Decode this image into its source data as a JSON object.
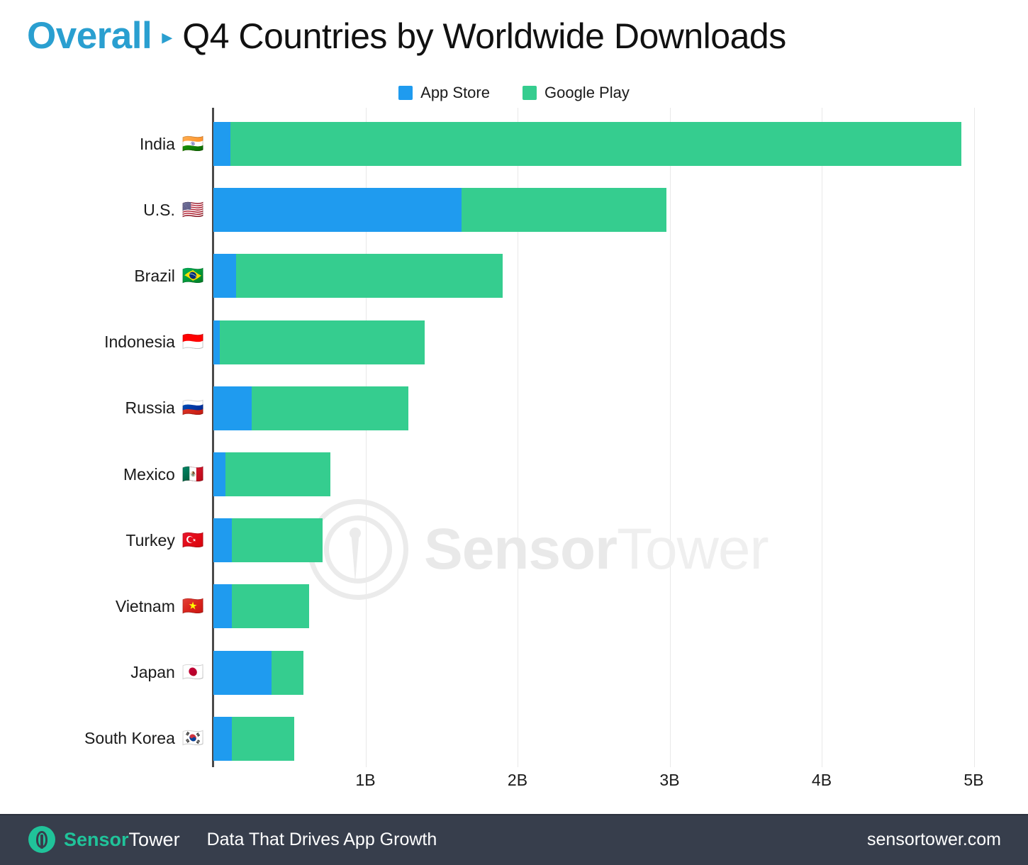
{
  "header": {
    "category": "Overall",
    "separator": "▸",
    "title": "Q4 Countries by Worldwide Downloads"
  },
  "legend": {
    "position": "top-center",
    "items": [
      {
        "label": "App Store",
        "color": "#1f9bef",
        "icon": "square-swatch"
      },
      {
        "label": "Google Play",
        "color": "#35cd8f",
        "icon": "square-swatch"
      }
    ]
  },
  "watermark": {
    "sensor": "Sensor",
    "tower": "Tower",
    "icon": "sensortower-logo-icon"
  },
  "footer": {
    "logo_icon": "sensortower-logo-icon",
    "brand_sensor": "Sensor",
    "brand_tower": "Tower",
    "tagline": "Data That Drives App Growth",
    "website": "sensortower.com"
  },
  "chart_data": {
    "type": "bar",
    "orientation": "horizontal",
    "stacked": true,
    "title": "Q4 Countries by Worldwide Downloads",
    "xlabel": "",
    "ylabel": "",
    "xlim": [
      0,
      5.4
    ],
    "xticks": [
      1,
      2,
      3,
      4,
      5
    ],
    "xtick_labels": [
      "1B",
      "2B",
      "3B",
      "4B",
      "5B"
    ],
    "grid": "vertical",
    "unit": "Billions of downloads",
    "categories": [
      "India",
      "U.S.",
      "Brazil",
      "Indonesia",
      "Russia",
      "Mexico",
      "Turkey",
      "Vietnam",
      "Japan",
      "South Korea"
    ],
    "category_flags": [
      "🇮🇳",
      "🇺🇸",
      "🇧🇷",
      "🇮🇩",
      "🇷🇺",
      "🇲🇽",
      "🇹🇷",
      "🇻🇳",
      "🇯🇵",
      "🇰🇷"
    ],
    "series": [
      {
        "name": "App Store",
        "color": "#1f9bef",
        "values": [
          0.11,
          1.63,
          0.15,
          0.04,
          0.25,
          0.08,
          0.12,
          0.12,
          0.38,
          0.12
        ]
      },
      {
        "name": "Google Play",
        "color": "#35cd8f",
        "values": [
          4.81,
          1.35,
          1.75,
          1.35,
          1.03,
          0.69,
          0.6,
          0.51,
          0.21,
          0.41
        ]
      }
    ],
    "totals": [
      4.92,
      2.98,
      1.9,
      1.39,
      1.28,
      0.77,
      0.72,
      0.63,
      0.59,
      0.53
    ]
  },
  "colors": {
    "accent_blue": "#2a9fd0",
    "app_store": "#1f9bef",
    "google_play": "#35cd8f",
    "footer_bg": "#373e4c",
    "brand_teal": "#20c39a"
  }
}
